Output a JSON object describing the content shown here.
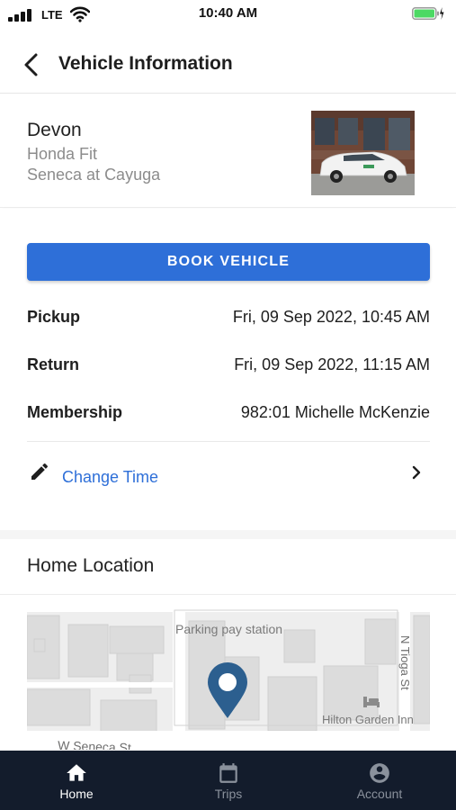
{
  "status_bar": {
    "carrier": "LTE",
    "time": "10:40 AM"
  },
  "header": {
    "title": "Vehicle Information"
  },
  "vehicle": {
    "name": "Devon",
    "model": "Honda Fit",
    "location": "Seneca at Cayuga"
  },
  "booking": {
    "book_label": "BOOK VEHICLE",
    "rows": [
      {
        "label": "Pickup",
        "value": "Fri, 09 Sep 2022, 10:45 AM"
      },
      {
        "label": "Return",
        "value": "Fri, 09 Sep 2022, 11:15 AM"
      },
      {
        "label": "Membership",
        "value": "982:01 Michelle McKenzie"
      }
    ],
    "change_time_label": "Change Time"
  },
  "home_location": {
    "title": "Home Location",
    "map_labels": {
      "parking": "Parking pay station",
      "hotel": "Hilton Garden Inn",
      "street_w_seneca": "W Seneca St",
      "street_n_tioga": "N Tioga St"
    }
  },
  "bottom_nav": {
    "items": [
      {
        "label": "Home",
        "icon": "home-icon",
        "active": true
      },
      {
        "label": "Trips",
        "icon": "calendar-icon",
        "active": false
      },
      {
        "label": "Account",
        "icon": "account-icon",
        "active": false
      }
    ]
  },
  "colors": {
    "accent": "#2e6fd8",
    "nav_bg": "#131c2c",
    "nav_active": "#ffffff",
    "nav_inactive": "#8a919c",
    "map_pin": "#2c5f8f"
  }
}
